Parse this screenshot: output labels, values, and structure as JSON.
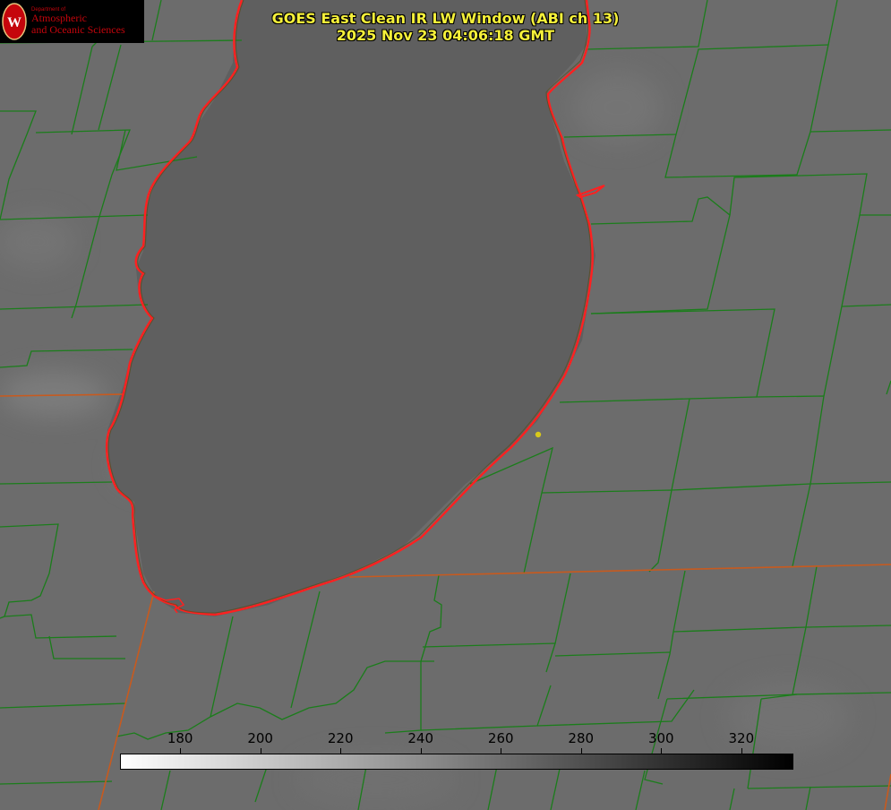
{
  "header": {
    "title": "GOES East Clean IR LW Window (ABI ch 13)",
    "timestamp": "2025 Nov 23 04:06:18 GMT"
  },
  "logo": {
    "department_label": "Department of",
    "line1": "Atmospheric",
    "line2": "and Oceanic Sciences",
    "letter": "W",
    "color": "#c5050c"
  },
  "colorbar": {
    "min": 165,
    "max": 333,
    "ticks": [
      "180",
      "200",
      "220",
      "240",
      "260",
      "280",
      "300",
      "320"
    ],
    "colors": [
      "#ffffff",
      "#000000"
    ]
  },
  "map": {
    "background_color": "#6e6e6e",
    "lake_color": "#5f5f5f",
    "county_line_color": "#1b7d1b",
    "state_line_color": "#c85a1e",
    "coastline_color": "#ff2020",
    "marker_color": "#d8c81a"
  }
}
